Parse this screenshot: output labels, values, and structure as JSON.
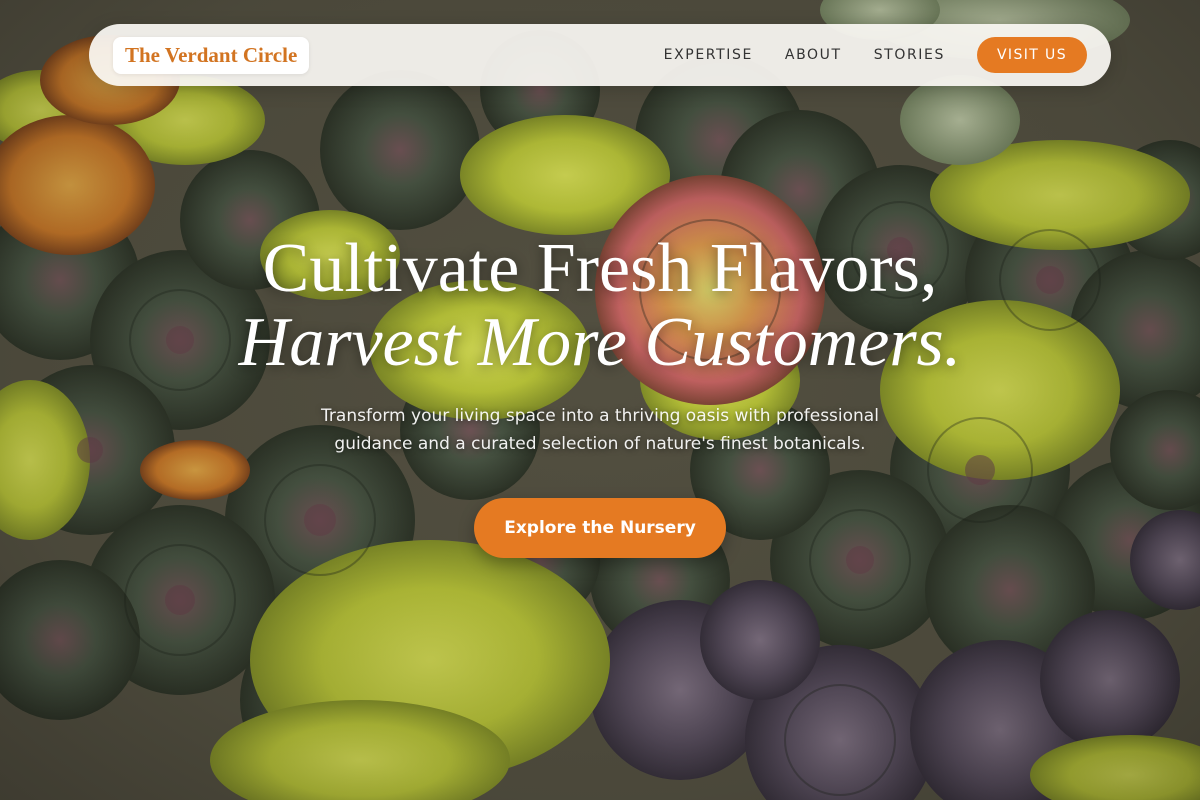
{
  "brand": {
    "name": "The Verdant Circle",
    "color": "#d27421"
  },
  "nav": {
    "links": [
      "EXPERTISE",
      "ABOUT",
      "STORIES"
    ],
    "cta_label": "VISIT US"
  },
  "hero": {
    "headline_line1": "Cultivate Fresh Flavors,",
    "headline_line2": "Harvest More Customers.",
    "subtitle": "Transform your living space into a thriving oasis with professional guidance and a curated selection of nature's finest botanicals.",
    "cta_label": "Explore the Nursery",
    "background_image": "succulent-garden-photo"
  },
  "colors": {
    "accent": "#e57a22",
    "navbar_bg": "#faf8f3",
    "text_dark": "#333333"
  }
}
